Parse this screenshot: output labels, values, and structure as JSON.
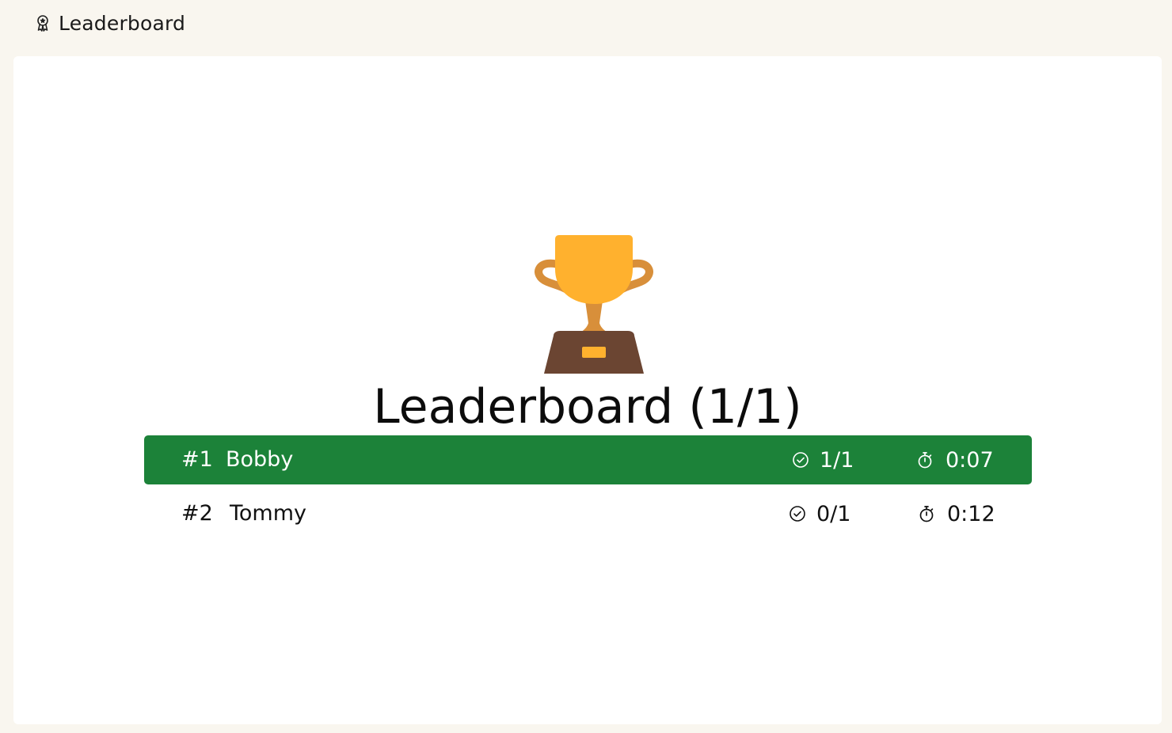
{
  "header": {
    "title": "Leaderboard",
    "icon": "award-ribbon-icon"
  },
  "board": {
    "title": "Leaderboard (1/1)",
    "trophy_icon": "trophy-icon",
    "highlight_color": "#1c8239",
    "entries": [
      {
        "rank": "#1",
        "name": "Bobby",
        "score": "1/1",
        "time": "0:07",
        "highlighted": true
      },
      {
        "rank": "#2",
        "name": "Tommy",
        "score": "0/1",
        "time": "0:12",
        "highlighted": false
      }
    ]
  }
}
